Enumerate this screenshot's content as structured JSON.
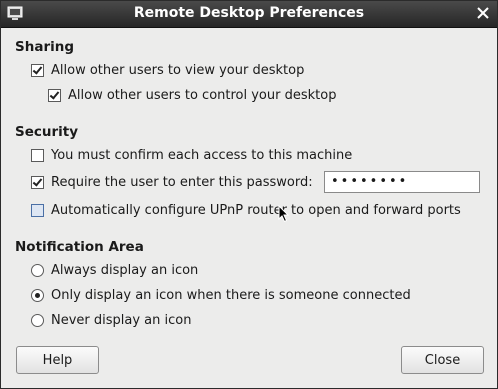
{
  "window": {
    "title": "Remote Desktop Preferences"
  },
  "sharing": {
    "heading": "Sharing",
    "allow_view": {
      "label": "Allow other users to view your desktop",
      "checked": true
    },
    "allow_control": {
      "label": "Allow other users to control your desktop",
      "checked": true
    }
  },
  "security": {
    "heading": "Security",
    "confirm_access": {
      "label": "You must confirm each access to this machine",
      "checked": false
    },
    "require_password": {
      "label": "Require the user to enter this password:",
      "checked": true
    },
    "password_value": "••••••••",
    "upnp": {
      "label": "Automatically configure UPnP router to open and forward ports",
      "checked": false
    }
  },
  "notification": {
    "heading": "Notification Area",
    "options": [
      {
        "label": "Always display an icon",
        "selected": false
      },
      {
        "label": "Only display an icon when there is someone connected",
        "selected": true
      },
      {
        "label": "Never display an icon",
        "selected": false
      }
    ]
  },
  "buttons": {
    "help": "Help",
    "close": "Close"
  },
  "icons": {
    "window": "remote-desktop-icon",
    "close": "close-icon",
    "cursor": "mouse-pointer-icon"
  }
}
